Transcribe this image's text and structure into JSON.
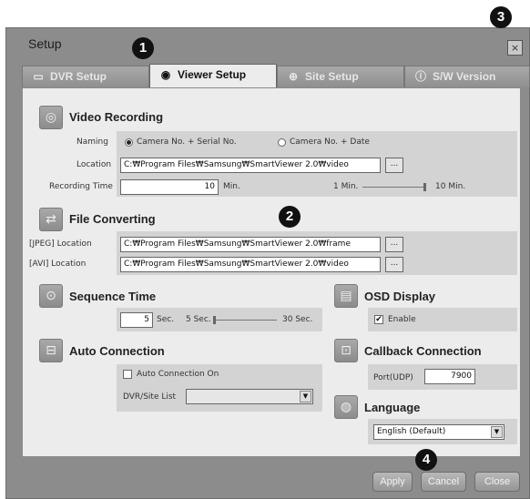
{
  "window": {
    "title": "Setup",
    "close_glyph": "×"
  },
  "tabs": [
    {
      "label": "DVR Setup",
      "icon": "dvr-icon"
    },
    {
      "label": "Viewer Setup",
      "icon": "eye-wrench-icon"
    },
    {
      "label": "Site Setup",
      "icon": "globe-wrench-icon"
    },
    {
      "label": "S/W Version",
      "icon": "info-icon"
    }
  ],
  "badges": [
    "1",
    "2",
    "3",
    "4"
  ],
  "video_recording": {
    "title": "Video Recording",
    "naming_label": "Naming",
    "naming_options": [
      "Camera No. + Serial No.",
      "Camera No. + Date"
    ],
    "location_label": "Location",
    "location_value": "C:₩Program Files₩Samsung₩SmartViewer 2.0₩video",
    "browse_label": "...",
    "recording_time_label": "Recording Time",
    "recording_time_value": "10",
    "recording_time_unit": "Min.",
    "slider_min": "1 Min.",
    "slider_max": "10 Min.",
    "slider_level": 1.0
  },
  "file_converting": {
    "title": "File Converting",
    "jpeg_label": "[JPEG]  Location",
    "jpeg_value": "C:₩Program Files₩Samsung₩SmartViewer 2.0₩frame",
    "avi_label": "[AVI]  Location",
    "avi_value": "C:₩Program Files₩Samsung₩SmartViewer 2.0₩video",
    "browse_label": "..."
  },
  "sequence_time": {
    "title": "Sequence Time",
    "value": "5",
    "unit": "Sec.",
    "slider_min": "5 Sec.",
    "slider_max": "30 Sec.",
    "slider_level": 0.0
  },
  "osd_display": {
    "title": "OSD Display",
    "enable_label": "Enable",
    "checked_glyph": "✔"
  },
  "auto_connection": {
    "title": "Auto Connection",
    "checkbox_label": "Auto Connection On",
    "list_label": "DVR/Site List",
    "list_value": ""
  },
  "callback_connection": {
    "title": "Callback Connection",
    "port_label": "Port(UDP)",
    "port_value": "7900"
  },
  "language": {
    "title": "Language",
    "value": "English (Default)"
  },
  "buttons": {
    "apply": "Apply",
    "cancel": "Cancel",
    "close": "Close"
  },
  "colors": {
    "panel": "#ececec",
    "frame": "#8c8c8c",
    "band": "#d3d3d3",
    "badge": "#111111"
  }
}
